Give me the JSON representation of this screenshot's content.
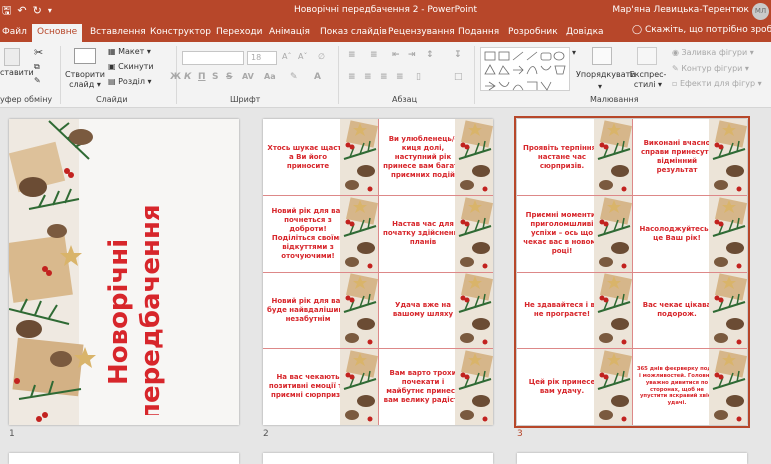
{
  "app": {
    "window_title": "Новорічні передбачення 2  -  PowerPoint",
    "user_name": "Мар'яна Левицька-Терентюк",
    "user_initials": "МЛ"
  },
  "tabs": [
    {
      "label": "Файл"
    },
    {
      "label": "Основне"
    },
    {
      "label": "Вставлення"
    },
    {
      "label": "Конструктор"
    },
    {
      "label": "Переходи"
    },
    {
      "label": "Анімація"
    },
    {
      "label": "Показ слайдів"
    },
    {
      "label": "Рецензування"
    },
    {
      "label": "Подання"
    },
    {
      "label": "Розробник"
    },
    {
      "label": "Довідка"
    }
  ],
  "tell_me": "Скажіть, що потрібно зробити",
  "ribbon": {
    "clipboard": {
      "paste": "ставити",
      "label": "уфер обміну"
    },
    "slides": {
      "new_slide_line1": "Створити",
      "new_slide_line2": "слайд",
      "layout": "Макет",
      "reset": "Скинути",
      "section": "Розділ",
      "label": "Слайди"
    },
    "font": {
      "size": "18",
      "bold": "Ж",
      "italic": "К",
      "underline": "П",
      "strike": "S",
      "label": "Шрифт"
    },
    "paragraph": {
      "label": "Абзац"
    },
    "drawing": {
      "arrange": "Упорядкувати",
      "quick_styles_line1": "Експрес-",
      "quick_styles_line2": "стилі",
      "fill": "Заливка фігури",
      "outline": "Контур фігури",
      "effects": "Ефекти для фігур",
      "label": "Малювання"
    }
  },
  "slides": [
    {
      "number": "1",
      "title_line1": "Новорічні",
      "title_line2": "передбачення"
    },
    {
      "number": "2",
      "cards": [
        "Хтось шукає щастя, а Ви його приносите",
        "Ви улюбленець/-киця долі, наступний рік принесе вам багато приємних подій",
        "Новий рік для вас почнеться з доброти! Поділіться своїми відкуттями з оточуючими!",
        "Настав час для початку здійснення планів",
        "Новий рік для вас буде найвдалішим і незабутнім",
        "Удача вже на вашому шляху",
        "На вас чекають позитивні емоції та приємні сюрпризи",
        "Вам варто трохи почекати і майбутнє принесе вам велику радість"
      ]
    },
    {
      "number": "3",
      "cards": [
        "Проявіть терпіння і настане час сюрпризів.",
        "Виконані вчасно справи принесуть відмінний результат",
        "Приємні моменти, приголомшливі успіхи – ось що чекає вас в новому році!",
        "Насолоджуйтесь – це Ваш рік!",
        "Не здавайтеся і ви не програєте!",
        "Вас чекає цікава подорож.",
        "Цей рік принесе вам удачу.",
        "365 днів феєрверку подій і можливостей. Головне, уважно дивитися по сторонах, щоб не упустити яскравий хвіст удачі."
      ]
    }
  ],
  "colors": {
    "accent": "#b7472a",
    "card_text": "#d7262b"
  }
}
